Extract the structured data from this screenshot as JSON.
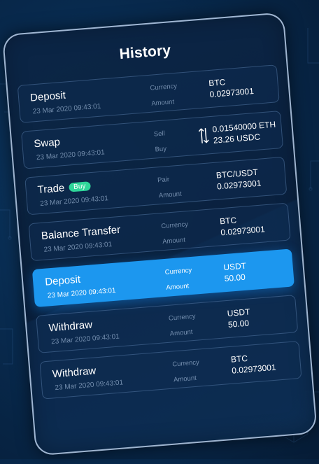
{
  "history": {
    "title": "History",
    "items": [
      {
        "title": "Deposit",
        "date": "23 Mar 2020  09:43:01",
        "label1": "Currency",
        "label2": "Amount",
        "value1": "BTC",
        "value2": "0.02973001"
      },
      {
        "title": "Swap",
        "date": "23 Mar 2020  09:43:01",
        "label1": "Sell",
        "label2": "Buy",
        "value1": "0.01540000 ETH",
        "value2": "23.26 USDC",
        "icon": "swap-arrows-icon"
      },
      {
        "title": "Trade",
        "badge": "Buy",
        "date": "23 Mar 2020  09:43:01",
        "label1": "Pair",
        "label2": "Amount",
        "value1": "BTC/USDT",
        "value2": "0.02973001"
      },
      {
        "title": "Balance Transfer",
        "date": "23 Mar 2020  09:43:01",
        "label1": "Currency",
        "label2": "Amount",
        "value1": "BTC",
        "value2": "0.02973001"
      },
      {
        "title": "Deposit",
        "date": "23 Mar 2020  09:43:01",
        "label1": "Currency",
        "label2": "Amount",
        "value1": "USDT",
        "value2": "50.00",
        "selected": true
      },
      {
        "title": "Withdraw",
        "date": "23 Mar 2020  09:43:01",
        "label1": "Currency",
        "label2": "Amount",
        "value1": "USDT",
        "value2": "50.00"
      },
      {
        "title": "Withdraw",
        "date": "23 Mar 2020  09:43:01",
        "label1": "Currency",
        "label2": "Amount",
        "value1": "BTC",
        "value2": "0.02973001"
      }
    ]
  },
  "colors": {
    "background": "#082a4e",
    "panel": "#0c2646",
    "accent": "#1c97ef",
    "badge": "#2fd69a",
    "muted_text": "#96afcd"
  }
}
